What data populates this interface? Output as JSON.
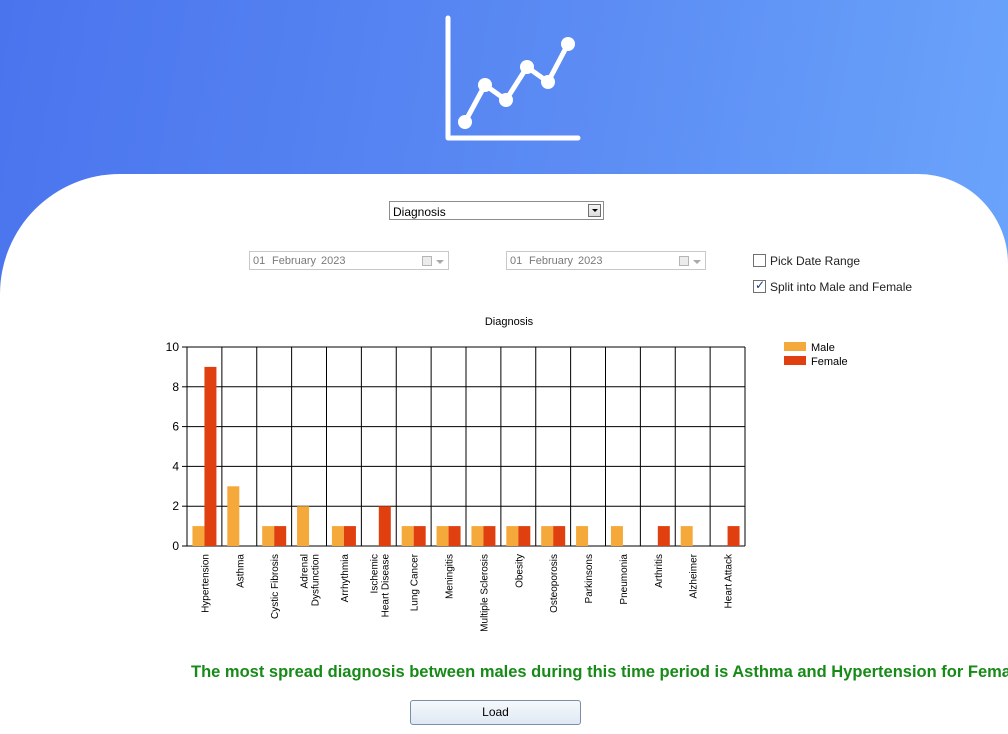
{
  "diagnosis_select": {
    "value": "Diagnosis"
  },
  "date_from": {
    "day": "01",
    "month": "February",
    "year": "2023"
  },
  "date_to": {
    "day": "01",
    "month": "February",
    "year": "2023"
  },
  "options": {
    "pick_date_range": {
      "label": "Pick Date Range",
      "checked": false
    },
    "split_gender": {
      "label": "Split into Male and Female",
      "checked": true
    }
  },
  "chart_data": {
    "type": "bar",
    "title": "Diagnosis",
    "xlabel": "",
    "ylabel": "",
    "ylim": [
      0,
      10
    ],
    "yticks": [
      0,
      2,
      4,
      6,
      8,
      10
    ],
    "grid": true,
    "legend_position": "top-right",
    "categories": [
      [
        "Hypertension"
      ],
      [
        "Asthma"
      ],
      [
        "Cystic Fibrosis"
      ],
      [
        "Adrenal",
        "Dysfunction"
      ],
      [
        "Arrhythmia"
      ],
      [
        "Ischemic",
        "Heart Disease"
      ],
      [
        "Lung Cancer"
      ],
      [
        "Meningitis"
      ],
      [
        "Multiple Sclerosis"
      ],
      [
        "Obesity"
      ],
      [
        "Osteoporosis"
      ],
      [
        "Parkinsons"
      ],
      [
        "Pneumonia"
      ],
      [
        "Arthritis"
      ],
      [
        "Alzheimer"
      ],
      [
        "Heart Attack"
      ]
    ],
    "series": [
      {
        "name": "Male",
        "color": "#f5a93b",
        "values": [
          1,
          3,
          1,
          2,
          1,
          0,
          1,
          1,
          1,
          1,
          1,
          1,
          1,
          0,
          1,
          0
        ]
      },
      {
        "name": "Female",
        "color": "#e0400f",
        "values": [
          9,
          0,
          1,
          0,
          1,
          2,
          1,
          1,
          1,
          1,
          1,
          0,
          0,
          1,
          0,
          1
        ]
      }
    ]
  },
  "summary_text": "The most spread diagnosis between males during this time period is Asthma and Hypertension for Females",
  "load_button": {
    "label": "Load"
  }
}
